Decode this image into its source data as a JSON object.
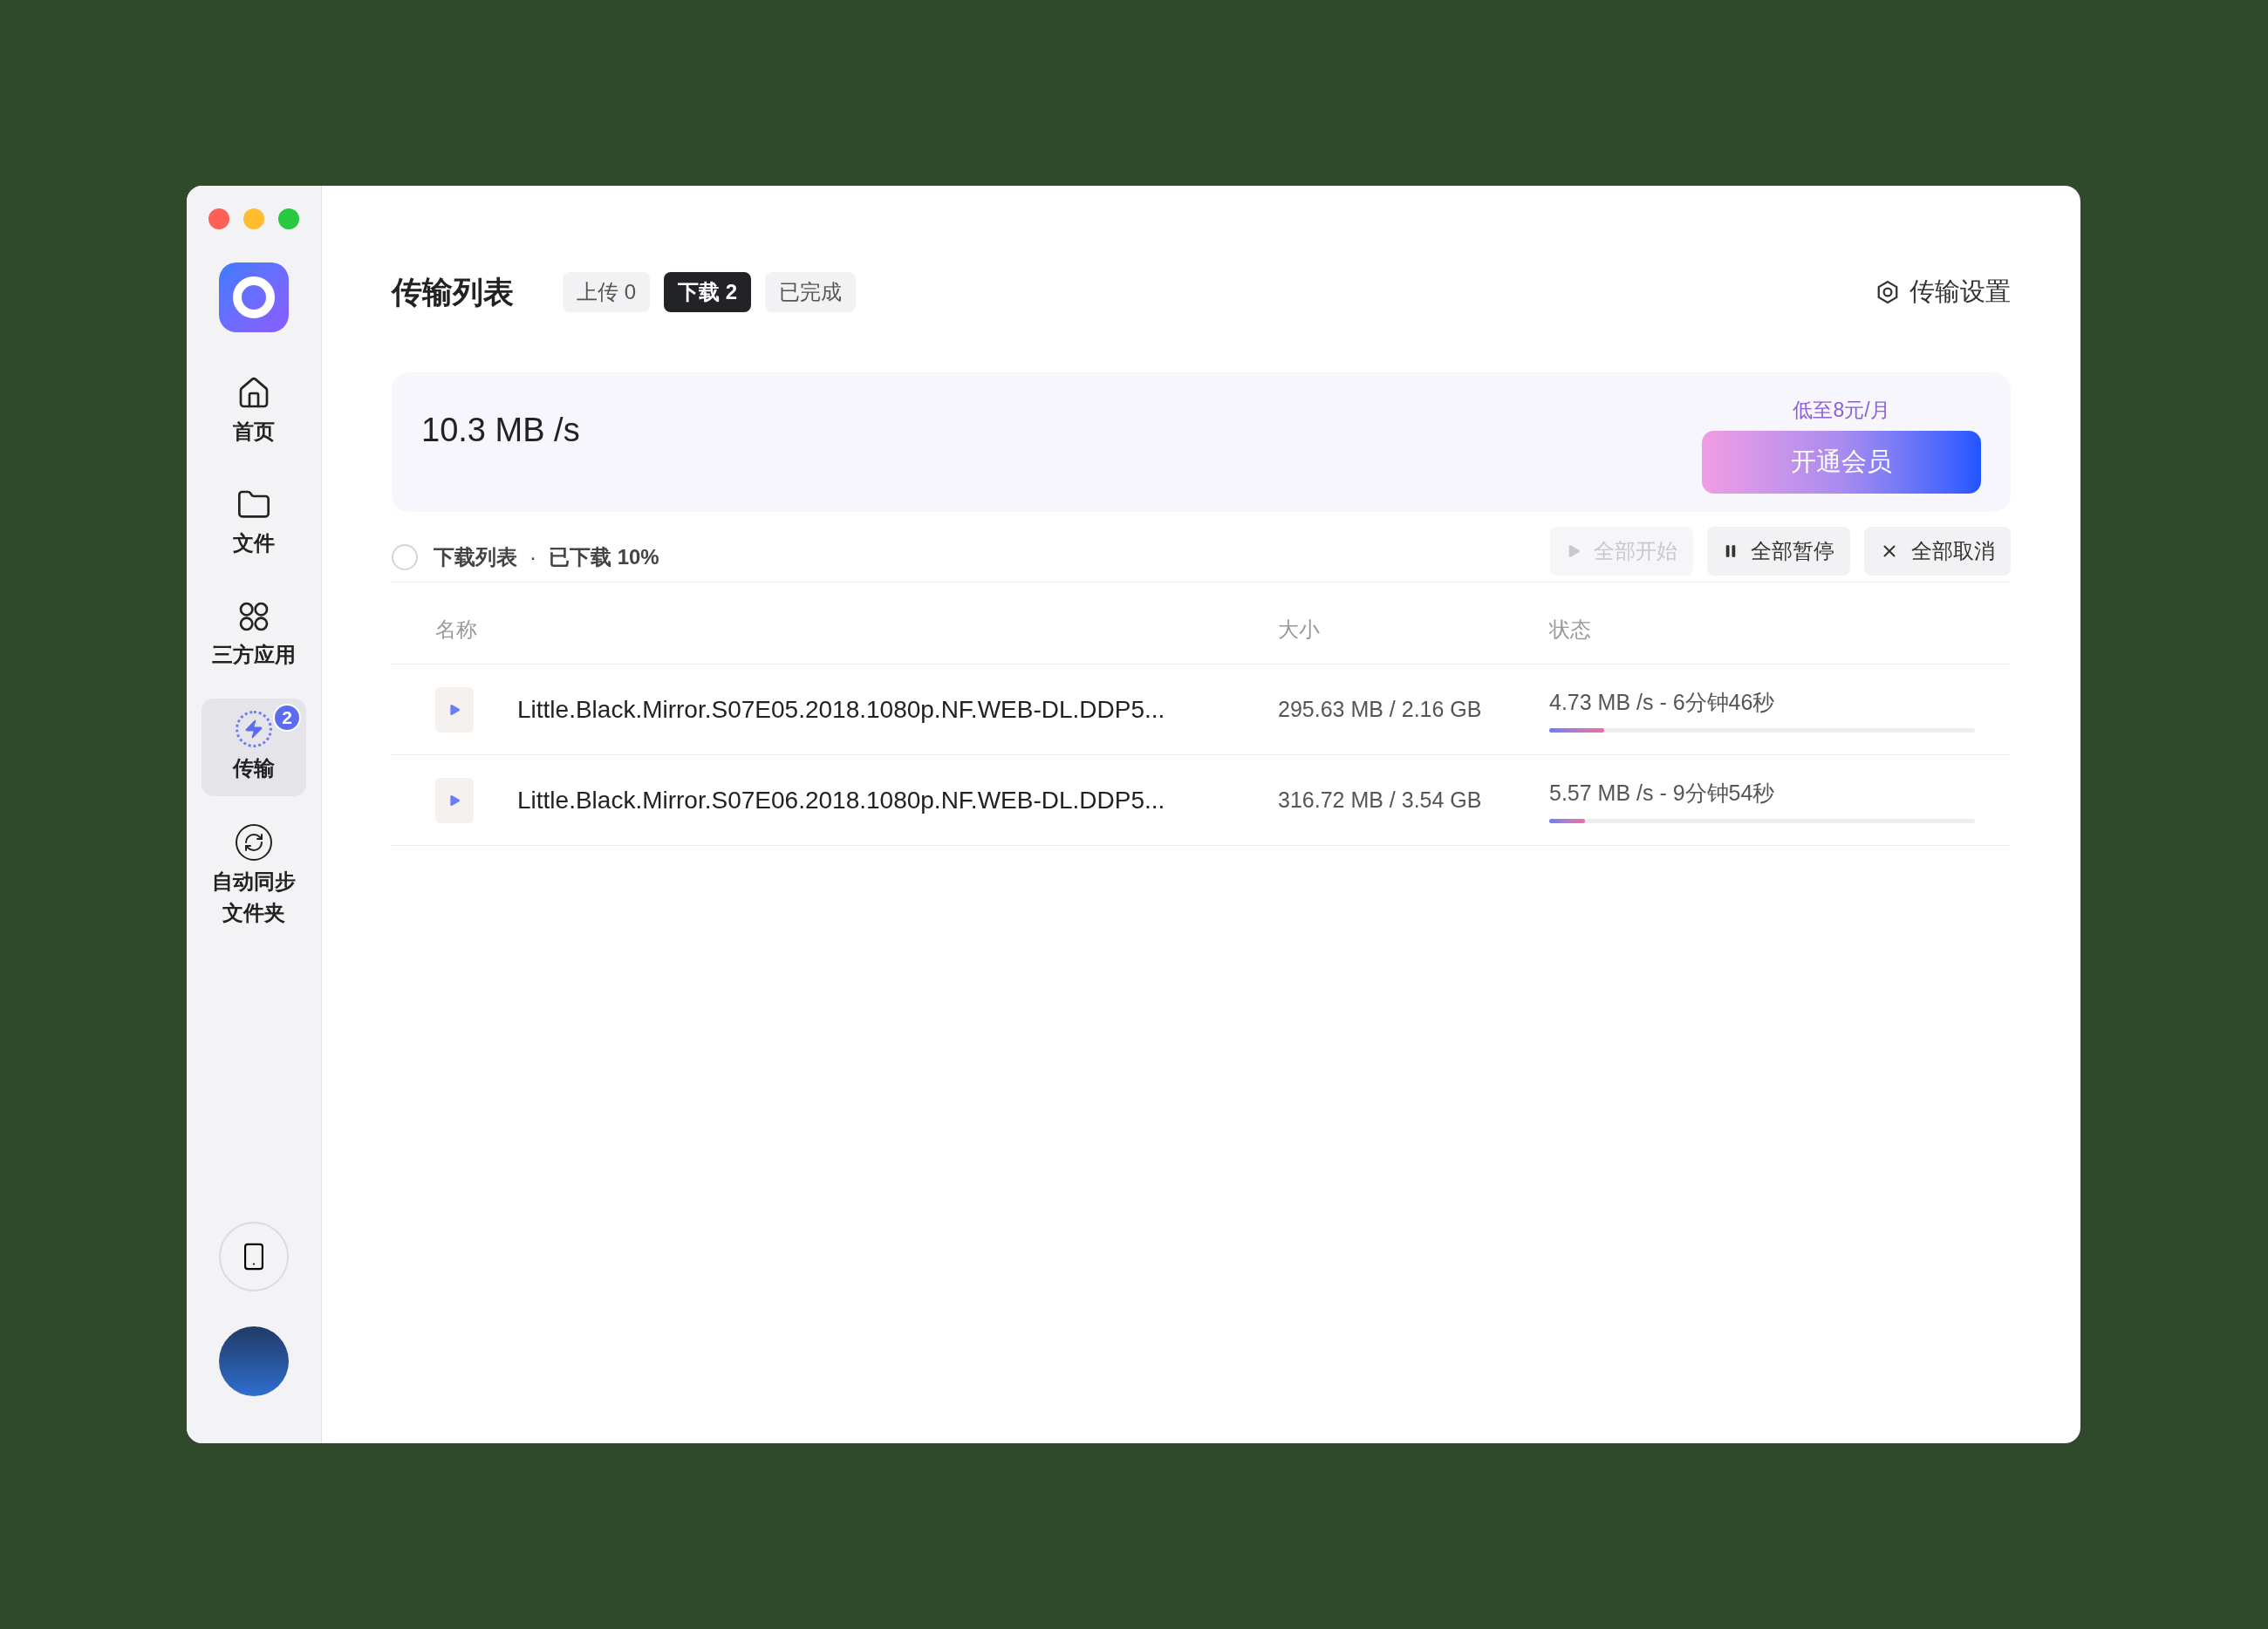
{
  "sidebar": {
    "items": [
      {
        "kind": "home",
        "label": "首页",
        "selected": false
      },
      {
        "kind": "folder",
        "label": "文件",
        "selected": false
      },
      {
        "kind": "apps",
        "label": "三方应用",
        "selected": false
      },
      {
        "kind": "transfer",
        "label": "传输",
        "selected": true,
        "badge": "2"
      },
      {
        "kind": "sync",
        "label": "自动同步文件夹",
        "selected": false
      }
    ]
  },
  "header": {
    "title": "传输列表",
    "tabs": [
      {
        "label": "上传 0",
        "selected": false
      },
      {
        "label": "下载 2",
        "selected": true
      },
      {
        "label": "已完成",
        "selected": false
      }
    ],
    "settings": "传输设置"
  },
  "speed_card": {
    "speed": "10.3 MB /s",
    "promo": "低至8元/月",
    "vip_button": "开通会员"
  },
  "toolbar": {
    "select_all_checked": false,
    "list_label": "下载列表",
    "separator": "·",
    "progress": "已下载 10%",
    "buttons": [
      {
        "kind": "start",
        "label": "全部开始",
        "disabled": true
      },
      {
        "kind": "pause",
        "label": "全部暂停",
        "disabled": false
      },
      {
        "kind": "cancel",
        "label": "全部取消",
        "disabled": false
      }
    ]
  },
  "table": {
    "columns": [
      "名称",
      "大小",
      "状态"
    ],
    "rows": [
      {
        "name": "Little.Black.Mirror.S07E05.2018.1080p.NF.WEB-DL.DDP5...",
        "size": "295.63 MB / 2.16 GB",
        "status": "4.73 MB /s - 6分钟46秒",
        "level": 0.13
      },
      {
        "name": "Little.Black.Mirror.S07E06.2018.1080p.NF.WEB-DL.DDP5...",
        "size": "316.72 MB / 3.54 GB",
        "status": "5.57 MB /s - 9分钟54秒",
        "level": 0.085
      }
    ]
  }
}
